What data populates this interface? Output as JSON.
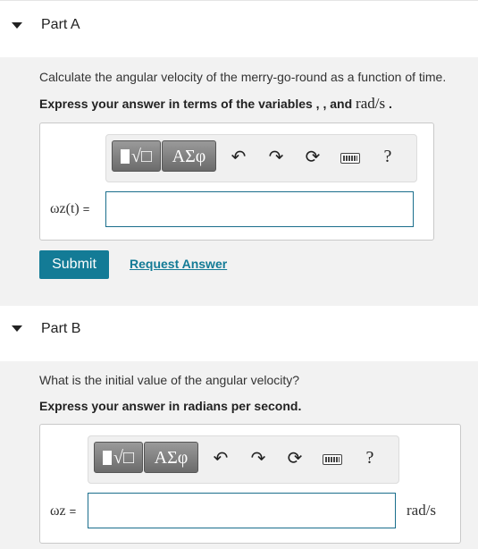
{
  "partA": {
    "title": "Part A",
    "question": "Calculate the angular velocity of the merry-go-round as a function of time.",
    "instruction_prefix": "Express your answer in terms of the variables , , and ",
    "instruction_unit": "rad/s",
    "instruction_suffix": " .",
    "toolbar": {
      "template_label": "√□",
      "symbols_label": "ΑΣφ",
      "help_label": "?"
    },
    "var_label": "ωz(t)",
    "equals": "=",
    "input_value": "",
    "submit_label": "Submit",
    "request_label": "Request Answer"
  },
  "partB": {
    "title": "Part B",
    "question": "What is the initial value of the angular velocity?",
    "instruction": "Express your answer in radians per second.",
    "toolbar": {
      "template_label": "√□",
      "symbols_label": "ΑΣφ",
      "help_label": "?"
    },
    "var_label": "ωz",
    "equals": "=",
    "input_value": "",
    "unit": "rad/s"
  },
  "icons": [
    "caret-down-icon",
    "undo-icon",
    "redo-icon",
    "reset-icon",
    "keyboard-icon",
    "help-icon"
  ]
}
